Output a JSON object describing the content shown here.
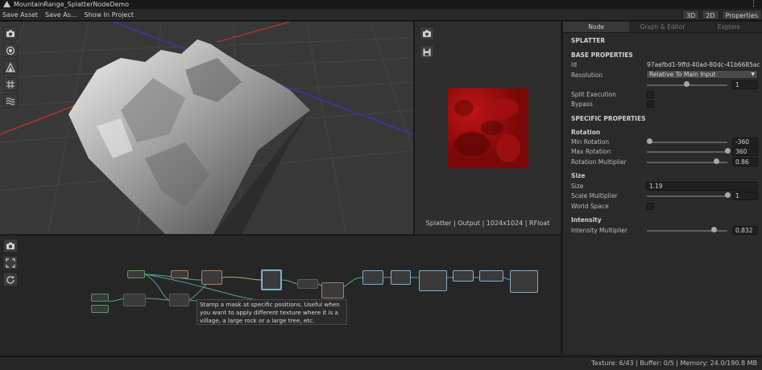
{
  "window": {
    "title": "MountainRange_SplatterNodeDemo",
    "menu_icon": "kebab-icon"
  },
  "toolbar": {
    "buttons": [
      "Save Asset",
      "Save As...",
      "Show In Project"
    ],
    "toggles": [
      "3D",
      "2D",
      "Properties"
    ]
  },
  "viewport": {
    "tools": [
      "camera-icon",
      "target-icon",
      "terrain-icon",
      "grid-icon",
      "waves-icon"
    ],
    "colors": {
      "background": "#383838",
      "axis_x": "#c0302f",
      "axis_z": "#3336c8"
    }
  },
  "preview": {
    "tools": [
      "camera-icon",
      "save-icon"
    ],
    "caption": "Splatter | Output | 1024x1024 | RFloat",
    "colors": {
      "texture": "#8a0b0b"
    }
  },
  "graph": {
    "tools": [
      "camera-icon",
      "frame-icon",
      "refresh-icon"
    ],
    "tooltip": "Stamp a mask at specific positions. Useful when you want to apply different texture where it is a village, a large rock or a large tree, etc."
  },
  "inspector": {
    "tabs": [
      "Node",
      "Graph & Editor",
      "Explore"
    ],
    "active_tab": "Node",
    "node_title": "SPLATTER",
    "base_properties": {
      "heading": "BASE PROPERTIES",
      "id_label": "Id",
      "id_value": "97aefbd1-9ffd-40ad-80dc-41b6685ac",
      "resolution_label": "Resolution",
      "resolution_value": "Relative To Main Input",
      "resolution_number": "1",
      "split_execution_label": "Split Execution",
      "bypass_label": "Bypass"
    },
    "specific_properties": {
      "heading": "SPECIFIC PROPERTIES",
      "rotation_heading": "Rotation",
      "min_rotation_label": "Min Rotation",
      "min_rotation_value": "-360",
      "max_rotation_label": "Max Rotation",
      "max_rotation_value": "360",
      "rotation_multiplier_label": "Rotation Multiplier",
      "rotation_multiplier_value": "0.86",
      "size_heading": "Size",
      "size_label": "Size",
      "size_value": "1.19",
      "scale_multiplier_label": "Scale Multiplier",
      "scale_multiplier_value": "1",
      "world_space_label": "World Space",
      "intensity_heading": "Intensity",
      "intensity_multiplier_label": "Intensity Multiplier",
      "intensity_multiplier_value": "0.832"
    }
  },
  "status": {
    "text": "Texture: 6/43 | Buffer: 0/5 | Memory: 24.0/190.8 MB"
  }
}
